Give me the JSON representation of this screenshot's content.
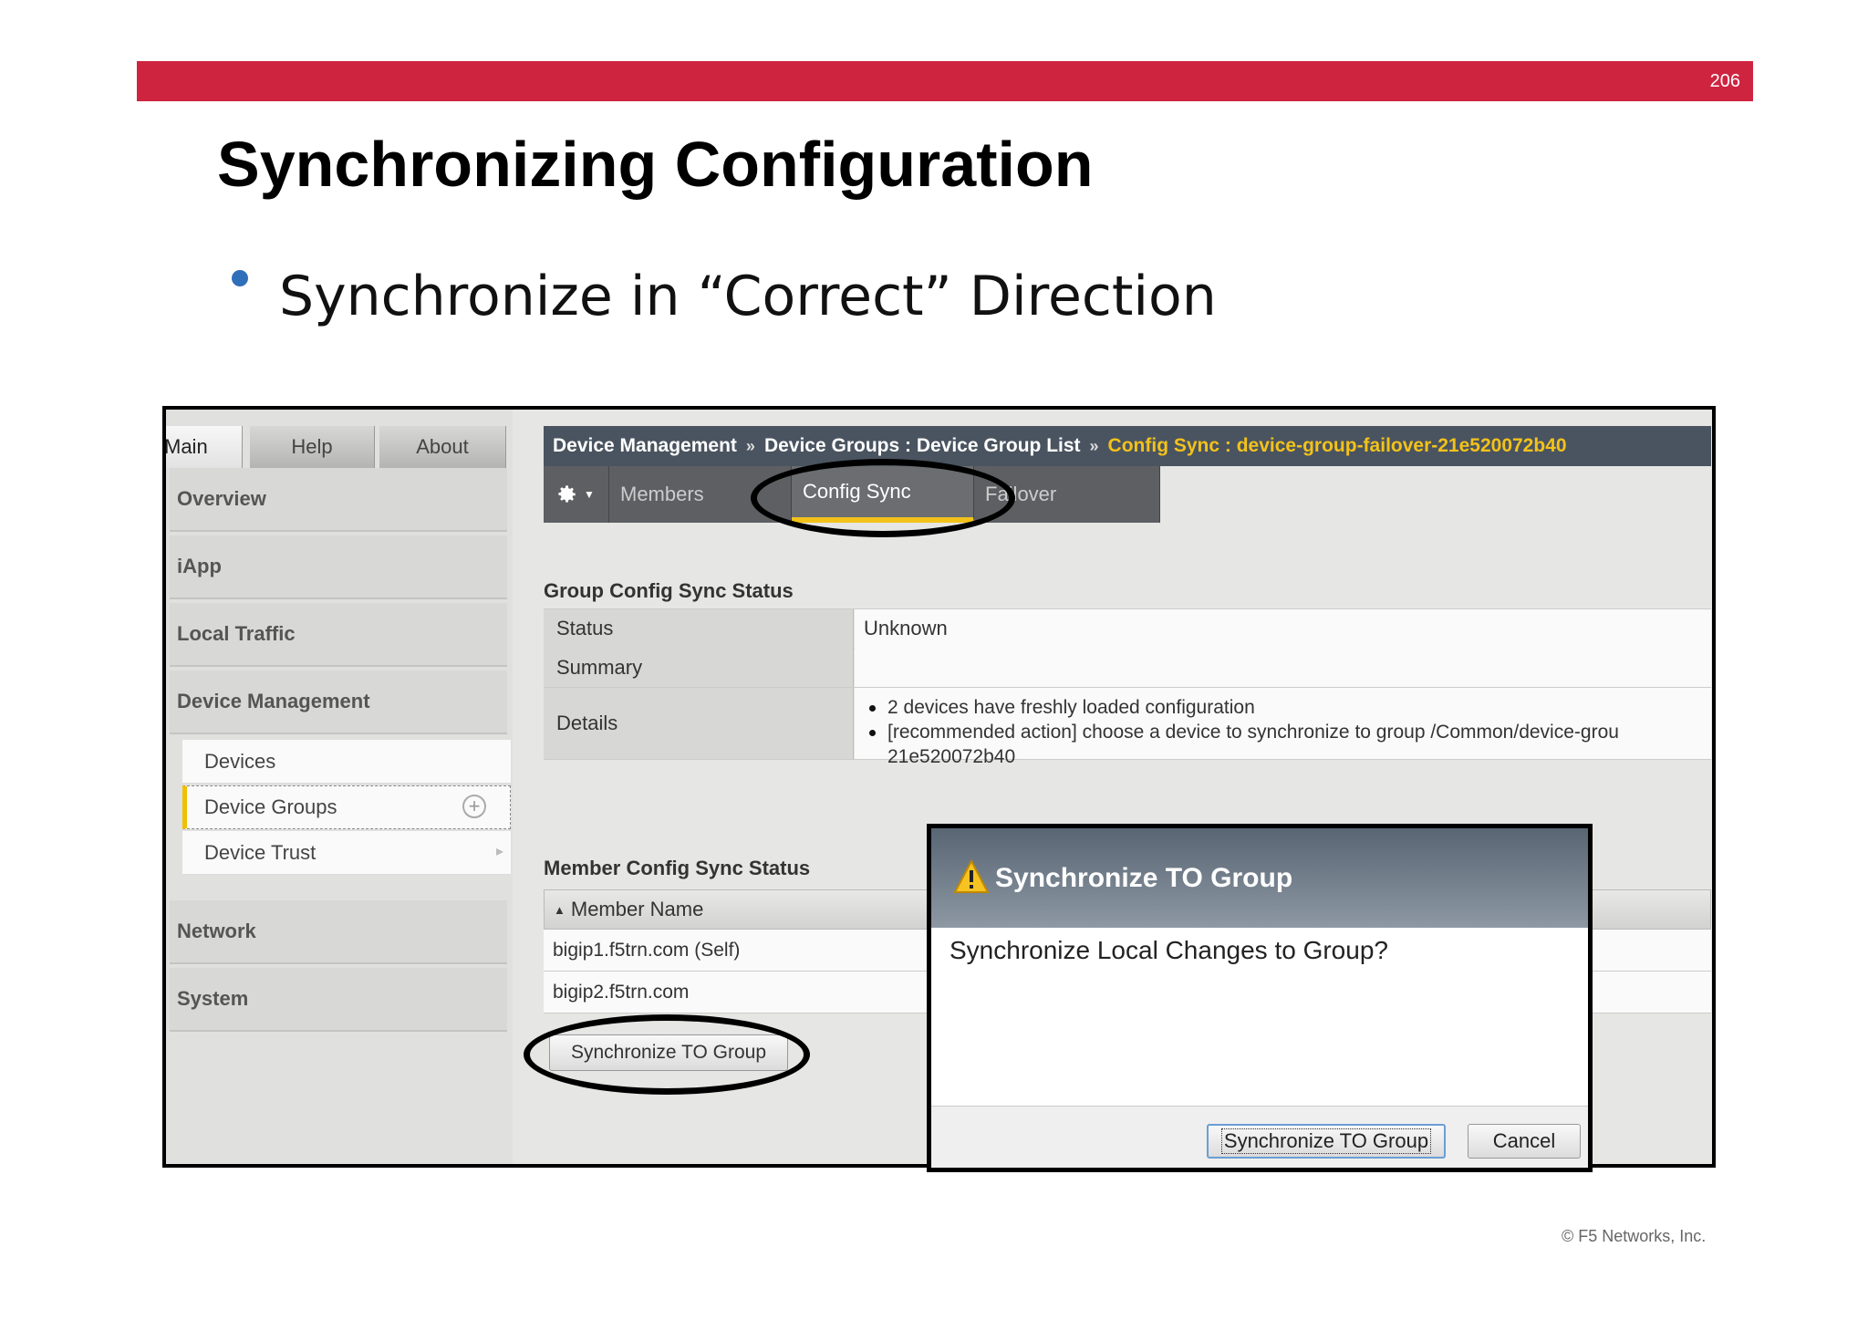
{
  "slide": {
    "number": "206",
    "title": "Synchronizing Configuration",
    "bullet": "Synchronize in “Correct” Direction",
    "copyright": "© F5 Networks, Inc.",
    "accent_color": "#cf2440"
  },
  "top_tabs": {
    "main": "Main",
    "help": "Help",
    "about": "About"
  },
  "nav": {
    "overview": "Overview",
    "iapp": "iApp",
    "local_traffic": "Local Traffic",
    "device_management": "Device Management",
    "devices": "Devices",
    "device_groups": "Device Groups",
    "device_trust": "Device Trust",
    "network": "Network",
    "system": "System"
  },
  "breadcrumb": {
    "part1": "Device Management",
    "part2": "Device Groups : Device Group List",
    "current": "Config Sync : device-group-failover-21e520072b40",
    "separator": "»"
  },
  "sub_tabs": {
    "members": "Members",
    "config_sync": "Config Sync",
    "failover": "Failover"
  },
  "group_status": {
    "title": "Group Config Sync Status",
    "status_label": "Status",
    "status_value": "Unknown",
    "summary_label": "Summary",
    "summary_value": "",
    "details_label": "Details",
    "details": [
      "2 devices have freshly loaded configuration",
      "[recommended action] choose a device to synchronize to group /Common/device-grou",
      "21e520072b40"
    ]
  },
  "member_status": {
    "title": "Member Config Sync Status",
    "column": "Member Name",
    "rows": [
      "bigip1.f5trn.com (Self)",
      "bigip2.f5trn.com"
    ]
  },
  "sync_button": "Synchronize TO Group",
  "dialog": {
    "title": "Synchronize TO Group",
    "message": "Synchronize Local Changes to Group?",
    "confirm": "Synchronize TO Group",
    "cancel": "Cancel"
  }
}
